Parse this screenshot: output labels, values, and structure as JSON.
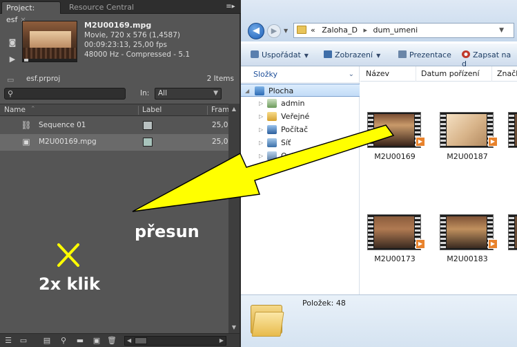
{
  "project_panel": {
    "tab_active": "Project: esf",
    "tab_inactive": "Resource Central",
    "clip": {
      "filename": "M2U00169.mpg",
      "line1": "Movie, 720 x 576 (1,4587)",
      "line2": "00:09:23:13, 25,00 fps",
      "line3": "48000 Hz - Compressed - 5.1"
    },
    "project_file": "esf.prproj",
    "item_count": "2 Items",
    "search_placeholder": "",
    "in_label": "In:",
    "in_value": "All",
    "columns": {
      "name": "Name",
      "label": "Label",
      "frame": "Fram"
    },
    "items": [
      {
        "name": "Sequence 01",
        "label_color": "#b8c0c0",
        "frame": "25,0",
        "icon": "sequence-icon"
      },
      {
        "name": "M2U00169.mpg",
        "label_color": "#a8c4bc",
        "frame": "25,0",
        "icon": "video-clip-icon"
      }
    ]
  },
  "explorer": {
    "breadcrumb_prefix": "«",
    "breadcrumb": [
      "Zaloha_D",
      "dum_umeni"
    ],
    "toolbar": {
      "organize": "Uspořádat",
      "views": "Zobrazení",
      "slideshow": "Prezentace",
      "burn": "Zapsat na d"
    },
    "nav_header": "Složky",
    "tree": [
      {
        "label": "Plocha",
        "icon": "desktop-icon"
      },
      {
        "label": "admin",
        "icon": "user-folder-icon"
      },
      {
        "label": "Veřejné",
        "icon": "public-folder-icon"
      },
      {
        "label": "Počítač",
        "icon": "computer-icon"
      },
      {
        "label": "Síť",
        "icon": "network-icon"
      },
      {
        "label": "Ovlád",
        "icon": "control-panel-icon"
      }
    ],
    "columns": [
      "Název",
      "Datum pořízení",
      "Značk"
    ],
    "files": [
      "M2U00169",
      "M2U00187",
      "M2U00173",
      "M2U00183"
    ],
    "status_count": "Položek: 48"
  },
  "annotations": {
    "move_label": "přesun",
    "double_click_label": "2x klik",
    "arrow_color": "#ffff00",
    "cross_color": "#ffff00"
  }
}
